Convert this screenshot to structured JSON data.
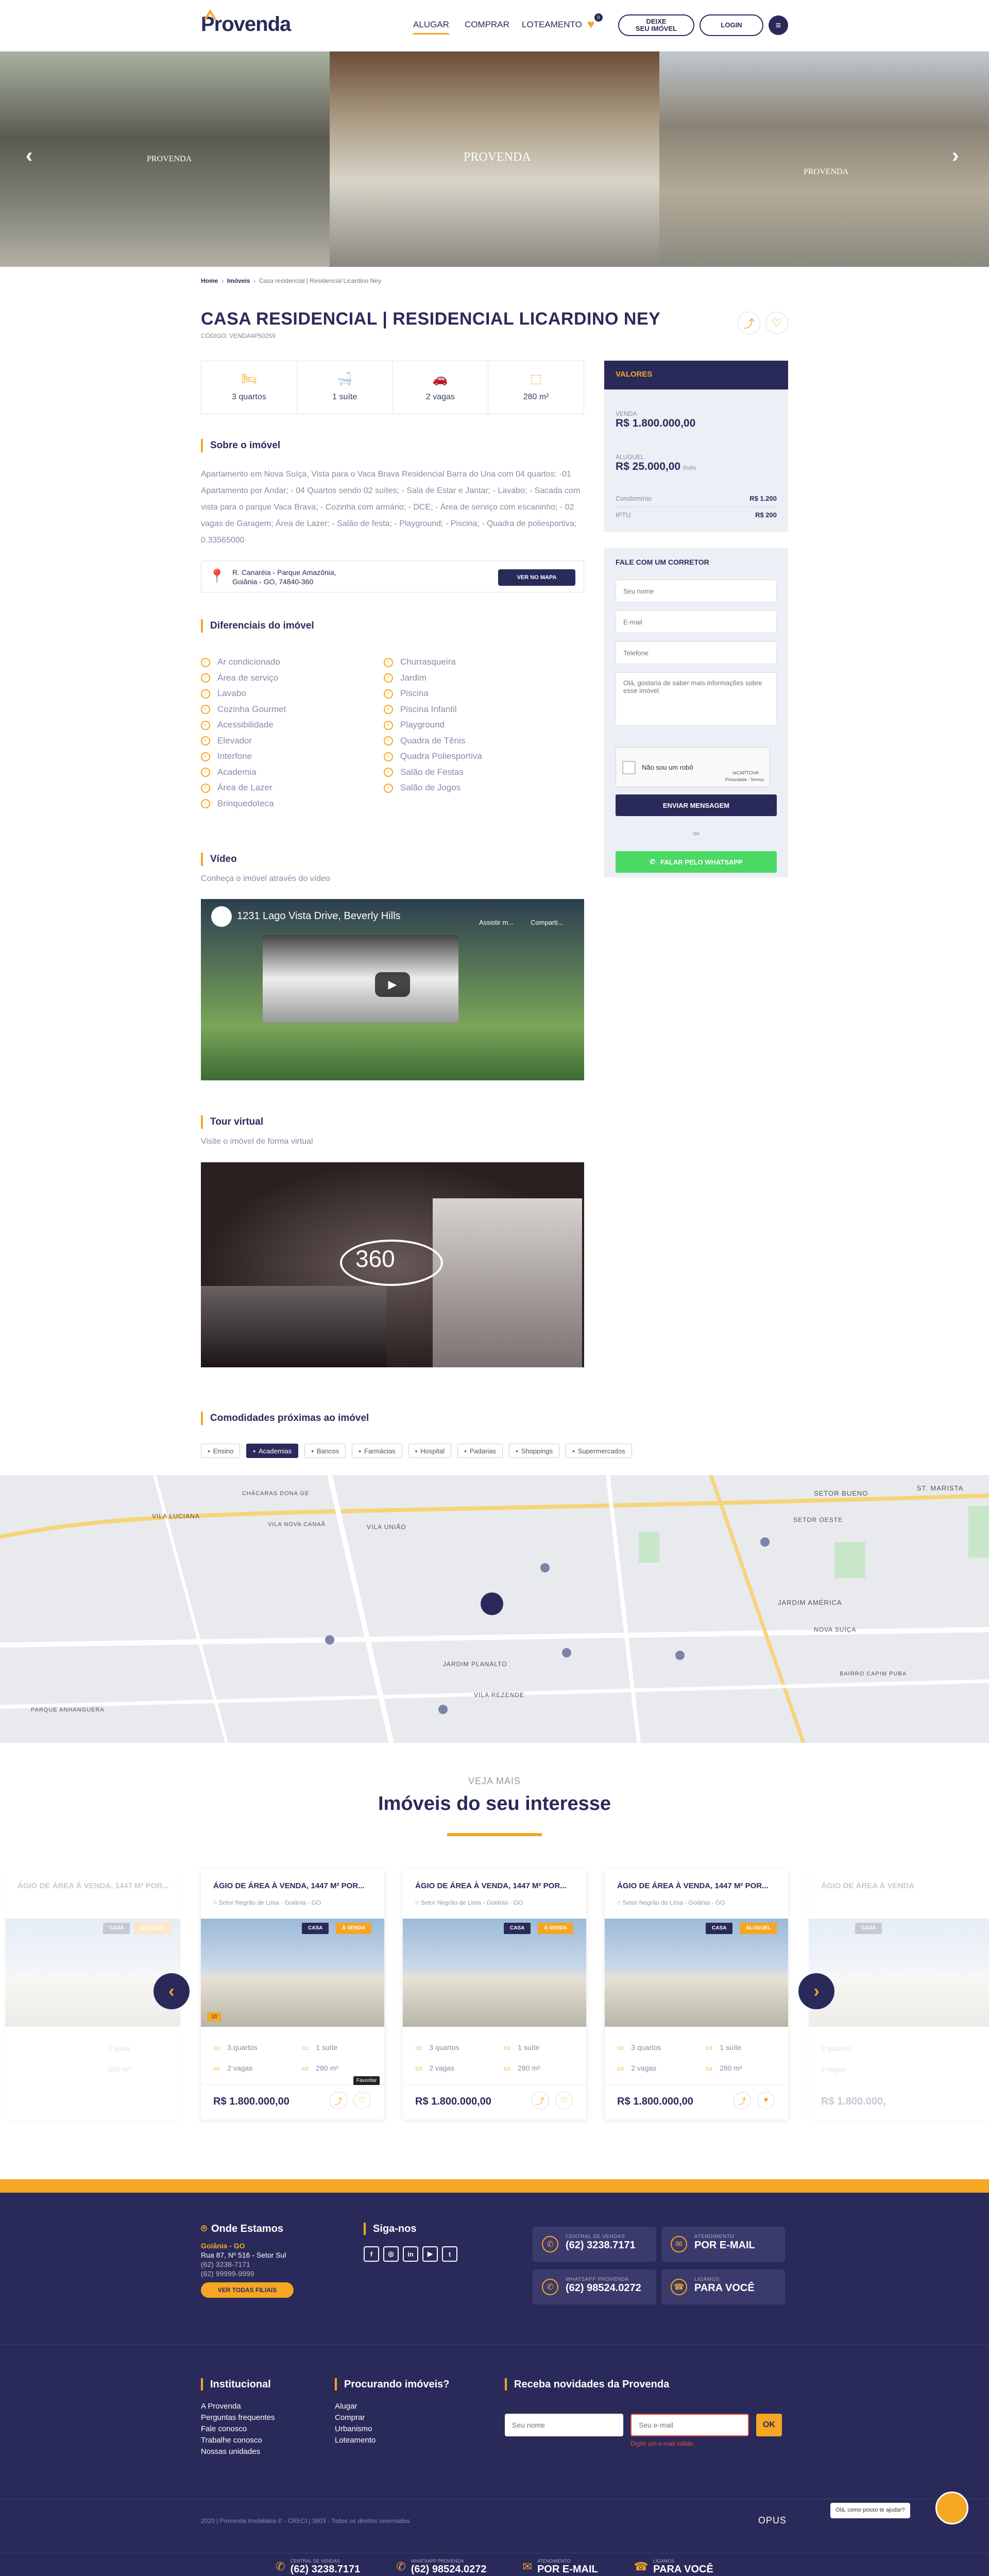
{
  "header": {
    "logo": "Provenda",
    "nav": [
      "ALUGAR",
      "COMPRAR",
      "LOTEAMENTO"
    ],
    "fav_count": "0",
    "deixe_label_1": "DEIXE",
    "deixe_label_2": "SEU IMÓVEL",
    "login_label": "LOGIN"
  },
  "hero": {
    "watermark": "PROVENDA"
  },
  "breadcrumb": [
    "Home",
    "Imóveis",
    "Casa residencial | Residencial Licardino Ney"
  ],
  "property": {
    "title": "CASA RESIDENCIAL | RESIDENCIAL LICARDINO NEY",
    "code": "CÓDIGO: VENDA4P50259",
    "features": [
      {
        "icon": "bed-icon",
        "label": "3 quartos"
      },
      {
        "icon": "bath-icon",
        "label": "1 suíte"
      },
      {
        "icon": "car-icon",
        "label": "2 vagas"
      },
      {
        "icon": "area-icon",
        "label": "280 m²"
      }
    ]
  },
  "about": {
    "title": "Sobre o imóvel",
    "text": "Apartamento em Nova Suíça, Vista para o Vaca Brava Residencial Barra do Una com 04 quartos: -01 Apartamento por Andar; - 04 Quartos sendo 02 suítes; - Sala de Estar e Jantar; - Lavabo; - Sacada com vista para o parque Vaca Brava; - Cozinha com armário; - DCE; - Área de serviço com escaninho; - 02 vagas de Garagem; Área de Lazer: - Salão de festa; - Playground; - Piscina; - Quadra de poliesportiva; 0.33565000"
  },
  "address": {
    "line1": "R. Canaréia - Parque Amazônia,",
    "line2": "Goiânia - GO, 74840-360",
    "map_button": "VER NO MAPA"
  },
  "diferenciais": {
    "title": "Diferenciais do imóvel",
    "col1": [
      "Ar condicionado",
      "Área de serviço",
      "Lavabo",
      "Cozinha Gourmet",
      "Acessibilidade",
      "Elevador",
      "Interfone",
      "Academia",
      "Área de Lazer",
      "Brinquedoteca"
    ],
    "col2": [
      "Churrasqueira",
      "Jardim",
      "Piscina",
      "Piscina Infantil",
      "Playground",
      "Quadra de Tênis",
      "Quadra Poliesportiva",
      "Salão de Festas",
      "Salão de Jogos"
    ]
  },
  "video": {
    "title": "Vídeo",
    "subtitle": "Conheça o imóvel através do vídeo",
    "caption": "1231 Lago Vista Drive, Beverly Hills",
    "watch_later": "Assistir m...",
    "share": "Comparti..."
  },
  "tour": {
    "title": "Tour virtual",
    "subtitle": "Visite o imóvel de forma virtual",
    "badge": "360"
  },
  "nearby": {
    "title": "Comodidades próximas ao imóvel",
    "chips": [
      "Ensino",
      "Academias",
      "Bancos",
      "Farmácias",
      "Hospital",
      "Padarias",
      "Shoppings",
      "Supermercados"
    ],
    "selected": "Academias"
  },
  "map_labels": [
    "VILA LUCIANA",
    "VILA UNIÃO",
    "SETOR BUENO",
    "JARDIM AMÉRICA",
    "ST. MARISTA",
    "NOVA SUÍÇA",
    "SETOR OESTE",
    "VILA NOVA CANAÃ",
    "CHÁCARAS DONA GE",
    "JARDIM PLANALTO",
    "VILA REZENDE",
    "BAIRRO CAPIM PUBA",
    "PARQUE ANHANGUERA"
  ],
  "values": {
    "header": "VALORES",
    "venda_label": "VENDA",
    "venda": "R$ 1.800.000,00",
    "aluguel_label": "ALUGUEL",
    "aluguel": "R$ 25.000,00",
    "aluguel_suffix": "/mês",
    "condominio_label": "Condomínio",
    "condominio": "R$ 1.200",
    "iptu_label": "IPTU",
    "iptu": "R$ 200"
  },
  "contact": {
    "title": "FALE COM UM CORRETOR",
    "name_ph": "Seu nome",
    "email_ph": "E-mail",
    "phone_ph": "Telefone",
    "message_ph": "Olá, gostaria de saber mais informações sobre esse imóvel.",
    "captcha": "Não sou um robô",
    "captcha_brand": "reCAPTCHA",
    "captcha_links": "Privacidade - Termos",
    "send": "ENVIAR MENSAGEM",
    "or": "ou",
    "whatsapp": "FALAR PELO WHATSAPP"
  },
  "interest": {
    "kicker": "VEJA MAIS",
    "title": "Imóveis do seu interesse",
    "cards": [
      {
        "title": "ÁGIO DE ÁREA À VENDA, 1447 M² POR...",
        "loc": "Setor Negrão de Lima - Goiânia - GO",
        "tag1": "CASA",
        "tag2": "À VENDA",
        "rooms": "3 quartos",
        "suite": "1 suíte",
        "cars": "2 vagas",
        "area": "280 m²",
        "price": "R$ 1.800.000,00",
        "photos": "10"
      },
      {
        "title": "ÁGIO DE ÁREA À VENDA, 1447 M² POR...",
        "loc": "Setor Negrão de Lima - Goiânia - GO",
        "tag1": "CASA",
        "tag2": "À VENDA",
        "rooms": "3 quartos",
        "suite": "1 suíte",
        "cars": "2 vagas",
        "area": "280 m²",
        "price": "R$ 1.800.000,00"
      },
      {
        "title": "ÁGIO DE ÁREA À VENDA, 1447 M² POR...",
        "loc": "Setor Negrão de Lima - Goiânia - GO",
        "tag1": "CASA",
        "tag2": "ALUGUEL",
        "rooms": "3 quartos",
        "suite": "1 suíte",
        "cars": "2 vagas",
        "area": "280 m²",
        "price": "R$ 1.800.000,00"
      }
    ],
    "faded_left": {
      "title": "ÁGIO DE ÁREA À VENDA, 1447 M² POR...",
      "tag1": "CASA",
      "tag2": "ALUGUEL",
      "suite": "1 suíte",
      "area": "280 m²"
    },
    "faded_right": {
      "title": "ÁGIO DE ÁREA À VENDA",
      "tag1": "CASA",
      "rooms": "3 quartos",
      "cars": "2 vagas",
      "price": "R$ 1.800.000,"
    },
    "tooltip": "Favoritar"
  },
  "footer": {
    "where_title": "Onde Estamos",
    "city": "Goiânia - GO",
    "street": "Rua 87, Nº 516 - Setor Sul",
    "phone1": "(62) 3238-7171",
    "phone2": "(62) 99999-9999",
    "branches_button": "VER TODAS FILIAIS",
    "follow_title": "Siga-nos",
    "social": [
      "f",
      "◎",
      "in",
      "▶",
      "t"
    ],
    "contacts": [
      {
        "small": "CENTRAL DE VENDAS",
        "big": "(62) 3238.7171"
      },
      {
        "small": "ATENDIMENTO",
        "big": "POR E-MAIL"
      },
      {
        "small": "WHATSAPP PROVENDA",
        "big": "(62) 98524.0272"
      },
      {
        "small": "LIGAMOS",
        "big": "PARA VOCÊ"
      }
    ],
    "inst_title": "Institucional",
    "inst_links": [
      "A Provenda",
      "Perguntas frequentes",
      "Fale conosco",
      "Trabalhe conosco",
      "Nossas unidades"
    ],
    "search_title": "Procurando imóveis?",
    "search_links": [
      "Alugar",
      "Comprar",
      "Urbanismo",
      "Loteamento"
    ],
    "news_title": "Receba novidades da Provenda",
    "news_name_ph": "Seu nome",
    "news_email_ph": "Seu e-mail",
    "news_ok": "OK",
    "news_error": "Digite um e-mail válido.",
    "copyright": "2020 | Provenda Imobiliária © - CRECI | 3803 - Todos os direitos reservados",
    "opus": "OPUS",
    "chat": "Olá, como posso te ajudar?"
  }
}
